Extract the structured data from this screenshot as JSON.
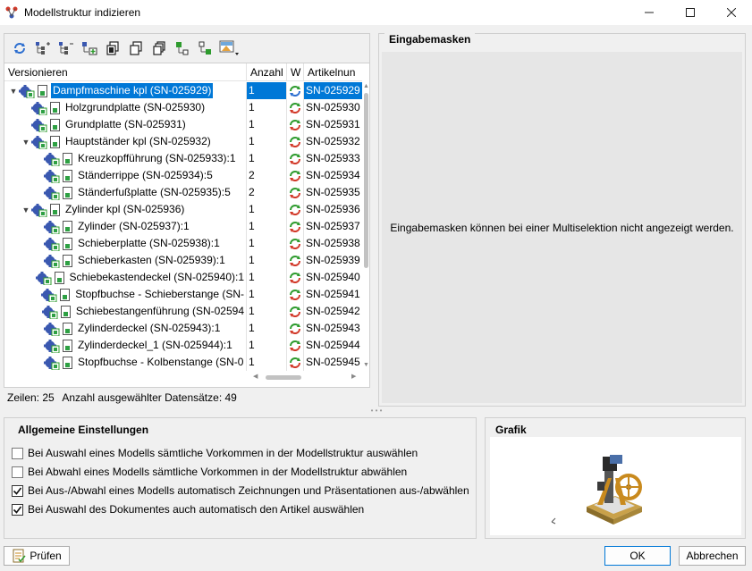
{
  "window": {
    "title": "Modellstruktur indizieren",
    "app_icon": "structure-icon",
    "minimize_icon": "minimize-icon",
    "maximize_icon": "maximize-icon",
    "close_icon": "close-icon"
  },
  "toolbar": {
    "icons": [
      "refresh-icon",
      "expand-tree-icon",
      "collapse-tree-icon",
      "add-item-icon",
      "copy-level-icon",
      "copy-icon",
      "copy-all-icon",
      "select-icon",
      "deselect-icon",
      "image-dropdown-icon"
    ]
  },
  "tree": {
    "columns": [
      "Versionieren",
      "Anzahl",
      "W",
      "Artikelnun"
    ],
    "rows": [
      {
        "name": "Dampfmaschine kpl (SN-025929)",
        "qty": "1",
        "art": "SN-025929",
        "level": 0,
        "expander": "▼",
        "selected": true,
        "w_icon": "status-partial-icon"
      },
      {
        "name": "Holzgrundplatte (SN-025930)",
        "qty": "1",
        "art": "SN-025930",
        "level": 1,
        "expander": "",
        "selected": false,
        "w_icon": "status-cycle-icon"
      },
      {
        "name": "Grundplatte (SN-025931)",
        "qty": "1",
        "art": "SN-025931",
        "level": 1,
        "expander": "",
        "selected": false,
        "w_icon": "status-cycle-icon"
      },
      {
        "name": "Hauptständer kpl (SN-025932)",
        "qty": "1",
        "art": "SN-025932",
        "level": 1,
        "expander": "▼",
        "selected": false,
        "w_icon": "status-cycle-icon"
      },
      {
        "name": "Kreuzkopfführung (SN-025933):1",
        "qty": "1",
        "art": "SN-025933",
        "level": 2,
        "expander": "",
        "selected": false,
        "w_icon": "status-cycle-icon"
      },
      {
        "name": "Ständerrippe (SN-025934):5",
        "qty": "2",
        "art": "SN-025934",
        "level": 2,
        "expander": "",
        "selected": false,
        "w_icon": "status-cycle-icon"
      },
      {
        "name": "Ständerfußplatte (SN-025935):5",
        "qty": "2",
        "art": "SN-025935",
        "level": 2,
        "expander": "",
        "selected": false,
        "w_icon": "status-cycle-icon"
      },
      {
        "name": "Zylinder kpl (SN-025936)",
        "qty": "1",
        "art": "SN-025936",
        "level": 1,
        "expander": "▼",
        "selected": false,
        "w_icon": "status-cycle-icon"
      },
      {
        "name": "Zylinder (SN-025937):1",
        "qty": "1",
        "art": "SN-025937",
        "level": 2,
        "expander": "",
        "selected": false,
        "w_icon": "status-cycle-icon"
      },
      {
        "name": "Schieberplatte (SN-025938):1",
        "qty": "1",
        "art": "SN-025938",
        "level": 2,
        "expander": "",
        "selected": false,
        "w_icon": "status-cycle-icon"
      },
      {
        "name": "Schieberkasten (SN-025939):1",
        "qty": "1",
        "art": "SN-025939",
        "level": 2,
        "expander": "",
        "selected": false,
        "w_icon": "status-cycle-icon"
      },
      {
        "name": "Schiebekastendeckel (SN-025940):1",
        "qty": "1",
        "art": "SN-025940",
        "level": 2,
        "expander": "",
        "selected": false,
        "w_icon": "status-cycle-icon"
      },
      {
        "name": "Stopfbuchse - Schieberstange (SN-",
        "qty": "1",
        "art": "SN-025941",
        "level": 2,
        "expander": "",
        "selected": false,
        "w_icon": "status-cycle-icon"
      },
      {
        "name": "Schiebestangenführung (SN-02594",
        "qty": "1",
        "art": "SN-025942",
        "level": 2,
        "expander": "",
        "selected": false,
        "w_icon": "status-cycle-icon"
      },
      {
        "name": "Zylinderdeckel (SN-025943):1",
        "qty": "1",
        "art": "SN-025943",
        "level": 2,
        "expander": "",
        "selected": false,
        "w_icon": "status-cycle-icon"
      },
      {
        "name": "Zylinderdeckel_1 (SN-025944):1",
        "qty": "1",
        "art": "SN-025944",
        "level": 2,
        "expander": "",
        "selected": false,
        "w_icon": "status-cycle-icon"
      },
      {
        "name": "Stopfbuchse - Kolbenstange (SN-0",
        "qty": "1",
        "art": "SN-025945",
        "level": 2,
        "expander": "",
        "selected": false,
        "w_icon": "status-cycle-icon"
      }
    ]
  },
  "status": {
    "rows_label": "Zeilen: 25",
    "selected_label": "Anzahl ausgewählter Datensätze: 49"
  },
  "input_masks": {
    "title": "Eingabemasken",
    "message": "Eingabemasken können bei einer Multiselektion nicht angezeigt werden."
  },
  "settings": {
    "title": "Allgemeine Einstellungen",
    "options": [
      {
        "label": "Bei Auswahl eines Modells sämtliche Vorkommen in der Modellstruktur auswählen",
        "checked": false
      },
      {
        "label": "Bei Abwahl eines Modells sämtliche Vorkommen in der Modellstruktur abwählen",
        "checked": false
      },
      {
        "label": "Bei Aus-/Abwahl eines Modells automatisch Zeichnungen und Präsentationen aus-/abwählen",
        "checked": true
      },
      {
        "label": "Bei Auswahl des Dokumentes auch automatisch den Artikel auswählen",
        "checked": true
      }
    ]
  },
  "preview": {
    "title": "Grafik",
    "image": "steam-engine-3d-preview"
  },
  "buttons": {
    "check": "Prüfen",
    "ok": "OK",
    "cancel": "Abbrechen"
  },
  "colors": {
    "selection": "#0078d7",
    "cycle_green": "#2e9b2e",
    "cycle_red": "#d23a2a",
    "gear_blue": "#3a58b0",
    "doc_green": "#2ea043"
  }
}
